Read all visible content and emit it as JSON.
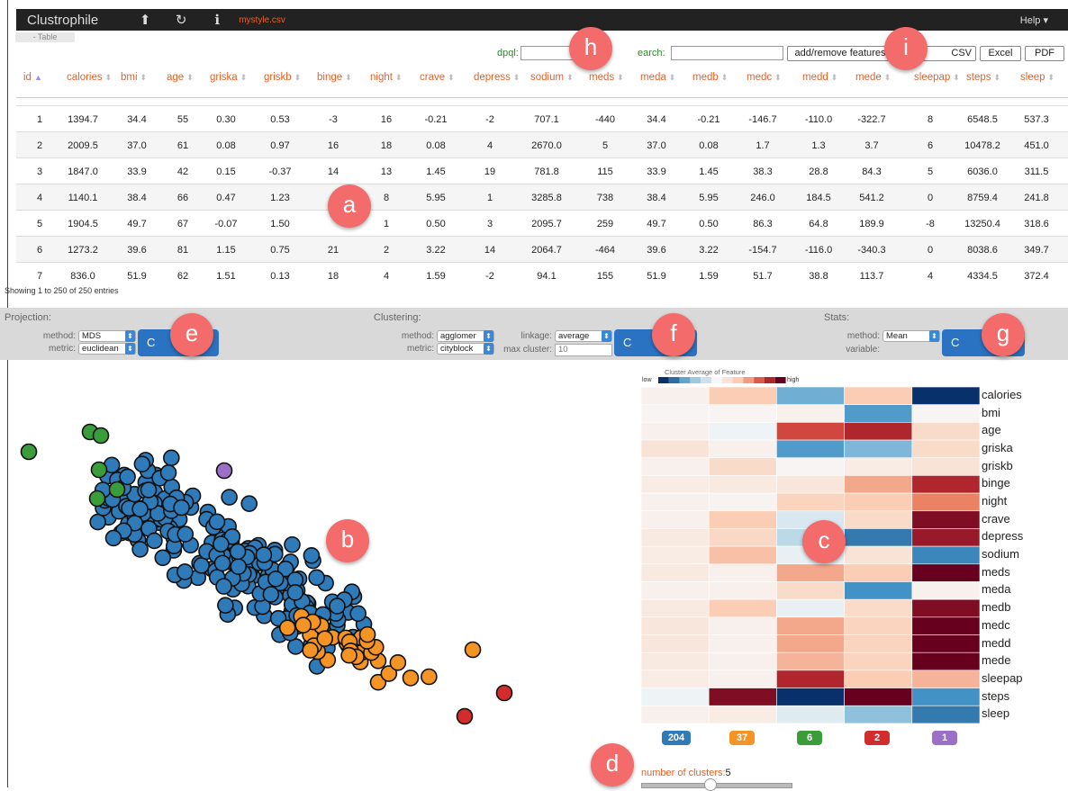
{
  "app": {
    "title": "Clustrophile",
    "file": "mystyle.csv",
    "help": "Help ▾",
    "tab": "- Table"
  },
  "toolbar": {
    "dpql_label": "dpql:",
    "search_label": "earch:",
    "add_remove": "add/remove features",
    "csv": "CSV",
    "excel": "Excel",
    "pdf": "PDF"
  },
  "table": {
    "columns": [
      "id",
      "calories",
      "bmi",
      "age",
      "griska",
      "griskb",
      "binge",
      "night",
      "crave",
      "depress",
      "sodium",
      "meds",
      "meda",
      "medb",
      "medc",
      "medd",
      "mede",
      "sleepap",
      "steps",
      "sleep"
    ],
    "rows": [
      [
        "1",
        "1394.7",
        "34.4",
        "55",
        "0.30",
        "0.53",
        "-3",
        "16",
        "-0.21",
        "-2",
        "707.1",
        "-440",
        "34.4",
        "-0.21",
        "-146.7",
        "-110.0",
        "-322.7",
        "8",
        "6548.5",
        "537.3"
      ],
      [
        "2",
        "2009.5",
        "37.0",
        "61",
        "0.08",
        "0.97",
        "16",
        "18",
        "0.08",
        "4",
        "2670.0",
        "5",
        "37.0",
        "0.08",
        "1.7",
        "1.3",
        "3.7",
        "6",
        "10478.2",
        "451.0"
      ],
      [
        "3",
        "1847.0",
        "33.9",
        "42",
        "0.15",
        "-0.37",
        "14",
        "13",
        "1.45",
        "19",
        "781.8",
        "115",
        "33.9",
        "1.45",
        "38.3",
        "28.8",
        "84.3",
        "5",
        "6036.0",
        "311.5"
      ],
      [
        "4",
        "1140.1",
        "38.4",
        "66",
        "0.47",
        "1.23",
        "",
        "8",
        "5.95",
        "1",
        "3285.8",
        "738",
        "38.4",
        "5.95",
        "246.0",
        "184.5",
        "541.2",
        "0",
        "8759.4",
        "241.8"
      ],
      [
        "5",
        "1904.5",
        "49.7",
        "67",
        "-0.07",
        "1.50",
        "",
        "1",
        "0.50",
        "3",
        "2095.7",
        "259",
        "49.7",
        "0.50",
        "86.3",
        "64.8",
        "189.9",
        "-8",
        "13250.4",
        "318.6"
      ],
      [
        "6",
        "1273.2",
        "39.6",
        "81",
        "1.15",
        "0.75",
        "21",
        "2",
        "3.22",
        "14",
        "2064.7",
        "-464",
        "39.6",
        "3.22",
        "-154.7",
        "-116.0",
        "-340.3",
        "0",
        "8038.6",
        "349.7"
      ],
      [
        "7",
        "836.0",
        "51.9",
        "62",
        "1.51",
        "0.13",
        "18",
        "4",
        "1.59",
        "-2",
        "94.1",
        "155",
        "51.9",
        "1.59",
        "51.7",
        "38.8",
        "113.7",
        "4",
        "4334.5",
        "372.4"
      ]
    ],
    "showing": "Showing 1 to 250 of 250 entries"
  },
  "projection": {
    "title": "Projection:",
    "method_label": "method:",
    "method": "MDS",
    "metric_label": "metric:",
    "metric": "euclidean"
  },
  "clustering": {
    "title": "Clustering:",
    "method_label": "method:",
    "method": "agglomer",
    "metric_label": "metric:",
    "metric": "cityblock",
    "linkage_label": "linkage:",
    "linkage": "average",
    "max_label": "max cluster:",
    "max_value": "10"
  },
  "stats": {
    "title": "Stats:",
    "method_label": "method:",
    "method": "Mean",
    "variable_label": "variable:"
  },
  "run_icon": "C",
  "callouts": [
    "a",
    "b",
    "c",
    "d",
    "e",
    "f",
    "g",
    "h",
    "i"
  ],
  "heatmap": {
    "title": "Cluster Average of Feature",
    "low": "low",
    "high": "high",
    "features": [
      "calories",
      "bmi",
      "age",
      "griska",
      "griskb",
      "binge",
      "night",
      "crave",
      "depress",
      "sodium",
      "meds",
      "meda",
      "medb",
      "medc",
      "medd",
      "mede",
      "sleepap",
      "steps",
      "sleep"
    ],
    "values": [
      [
        0.05,
        0.3,
        -0.45,
        0.3,
        -1.0
      ],
      [
        0.02,
        0.02,
        0.05,
        -0.55,
        0.02
      ],
      [
        0.05,
        -0.03,
        0.75,
        0.85,
        0.2
      ],
      [
        0.15,
        0.05,
        -0.55,
        -0.4,
        0.2
      ],
      [
        0.05,
        0.2,
        0.02,
        0.08,
        0.15
      ],
      [
        0.08,
        0.1,
        0.12,
        0.45,
        0.85
      ],
      [
        0.05,
        0.03,
        0.25,
        0.3,
        0.6
      ],
      [
        0.05,
        0.3,
        -0.1,
        0.2,
        0.95
      ],
      [
        0.1,
        0.22,
        -0.2,
        -0.7,
        0.9
      ],
      [
        0.08,
        0.35,
        -0.05,
        0.15,
        -0.65
      ],
      [
        0.1,
        0.05,
        0.45,
        0.3,
        1.0
      ],
      [
        0.05,
        0.05,
        0.2,
        -0.6,
        0.05
      ],
      [
        0.1,
        0.3,
        -0.05,
        0.2,
        0.95
      ],
      [
        0.12,
        0.05,
        0.45,
        0.25,
        1.0
      ],
      [
        0.12,
        0.05,
        0.45,
        0.25,
        1.0
      ],
      [
        0.1,
        0.05,
        0.4,
        0.25,
        1.0
      ],
      [
        0.08,
        0.05,
        0.85,
        0.3,
        0.4
      ],
      [
        -0.03,
        0.95,
        -1.0,
        1.0,
        -0.6
      ],
      [
        0.05,
        0.08,
        -0.08,
        -0.35,
        -0.7
      ]
    ],
    "clusters": [
      {
        "count": "204",
        "color": "#2f7ab9"
      },
      {
        "count": "37",
        "color": "#f39424"
      },
      {
        "count": "6",
        "color": "#3a9d3a"
      },
      {
        "count": "2",
        "color": "#d22c2c"
      },
      {
        "count": "1",
        "color": "#9b6fc6"
      }
    ]
  },
  "slider": {
    "label": "number of clusters:",
    "value": "5"
  },
  "colors": {
    "accent": "#e4622a",
    "callout": "#f36b6b",
    "button": "#2a73c2"
  }
}
